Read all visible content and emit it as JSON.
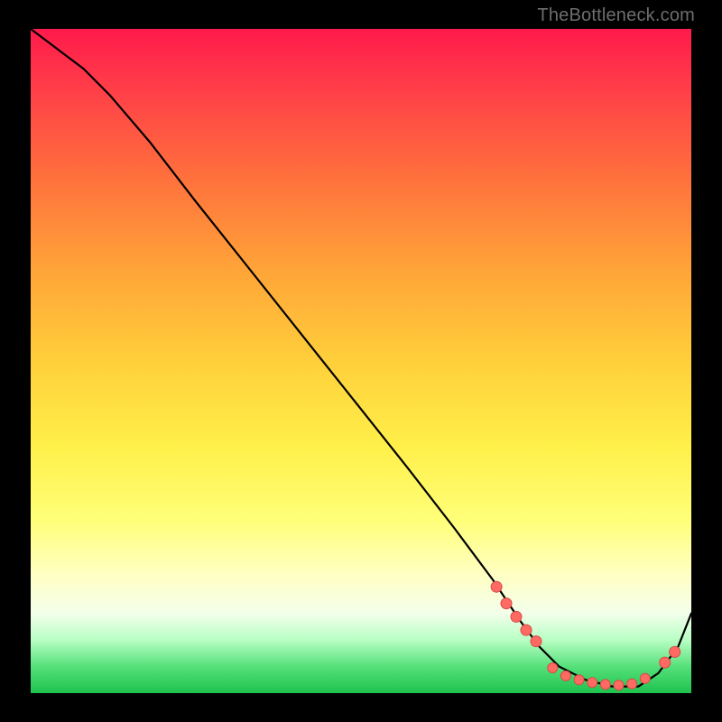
{
  "watermark": "TheBottleneck.com",
  "colors": {
    "curve": "#000000",
    "marker_fill": "#ff6b63",
    "marker_stroke": "#d94a46",
    "gradient_stops": [
      "#ff1a4b",
      "#ff3a49",
      "#ff6f3d",
      "#ffa338",
      "#ffcf3a",
      "#fff04a",
      "#ffff79",
      "#ffffc2",
      "#f3ffeb",
      "#b8ffc4",
      "#55e07a",
      "#1ec24e"
    ]
  },
  "chart_data": {
    "type": "line",
    "title": "",
    "xlabel": "",
    "ylabel": "",
    "xlim": [
      0,
      100
    ],
    "ylim": [
      0,
      100
    ],
    "series": [
      {
        "name": "curve",
        "x": [
          0,
          4,
          8,
          12,
          18,
          25,
          33,
          41,
          49,
          57,
          64,
          70,
          74,
          77,
          80,
          84,
          88,
          92,
          95,
          98,
          100
        ],
        "y": [
          100,
          97,
          94,
          90,
          83,
          74,
          64,
          54,
          44,
          34,
          25,
          17,
          11,
          7,
          4,
          2,
          1,
          1,
          3,
          7,
          12
        ]
      }
    ],
    "markers": {
      "descending_cluster": {
        "x": [
          70.5,
          72,
          73.5,
          75,
          76.5
        ],
        "y": [
          16,
          13.5,
          11.5,
          9.5,
          7.8
        ]
      },
      "flat_cluster": {
        "x": [
          79,
          81,
          83,
          85,
          87,
          89,
          91,
          93
        ],
        "y": [
          3.8,
          2.6,
          2.0,
          1.6,
          1.3,
          1.2,
          1.4,
          2.2
        ]
      },
      "rising_cluster": {
        "x": [
          96,
          97.5
        ],
        "y": [
          4.6,
          6.2
        ]
      }
    }
  }
}
